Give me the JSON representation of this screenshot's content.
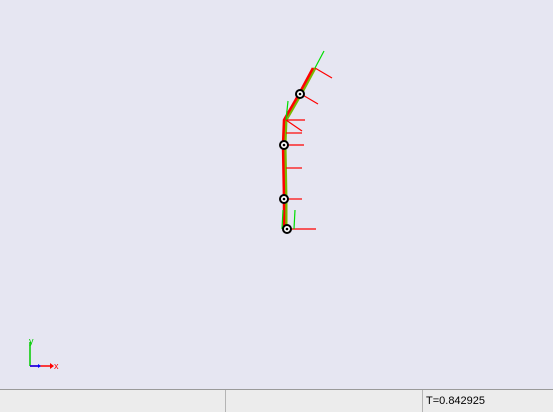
{
  "viewport": {
    "background": "#e6e6f2",
    "link_color": "#ff0000",
    "link_shadow_color": "#7ab800",
    "x_axis_color": "#ff0000",
    "y_axis_color": "#00ff00",
    "z_axis_color": "#0000ff",
    "joint_color": "#000000"
  },
  "axis_triad": {
    "x_label": "x",
    "y_label": "y"
  },
  "statusbar": {
    "cell1": "",
    "cell2": "",
    "time_readout": "T=0.842925"
  }
}
